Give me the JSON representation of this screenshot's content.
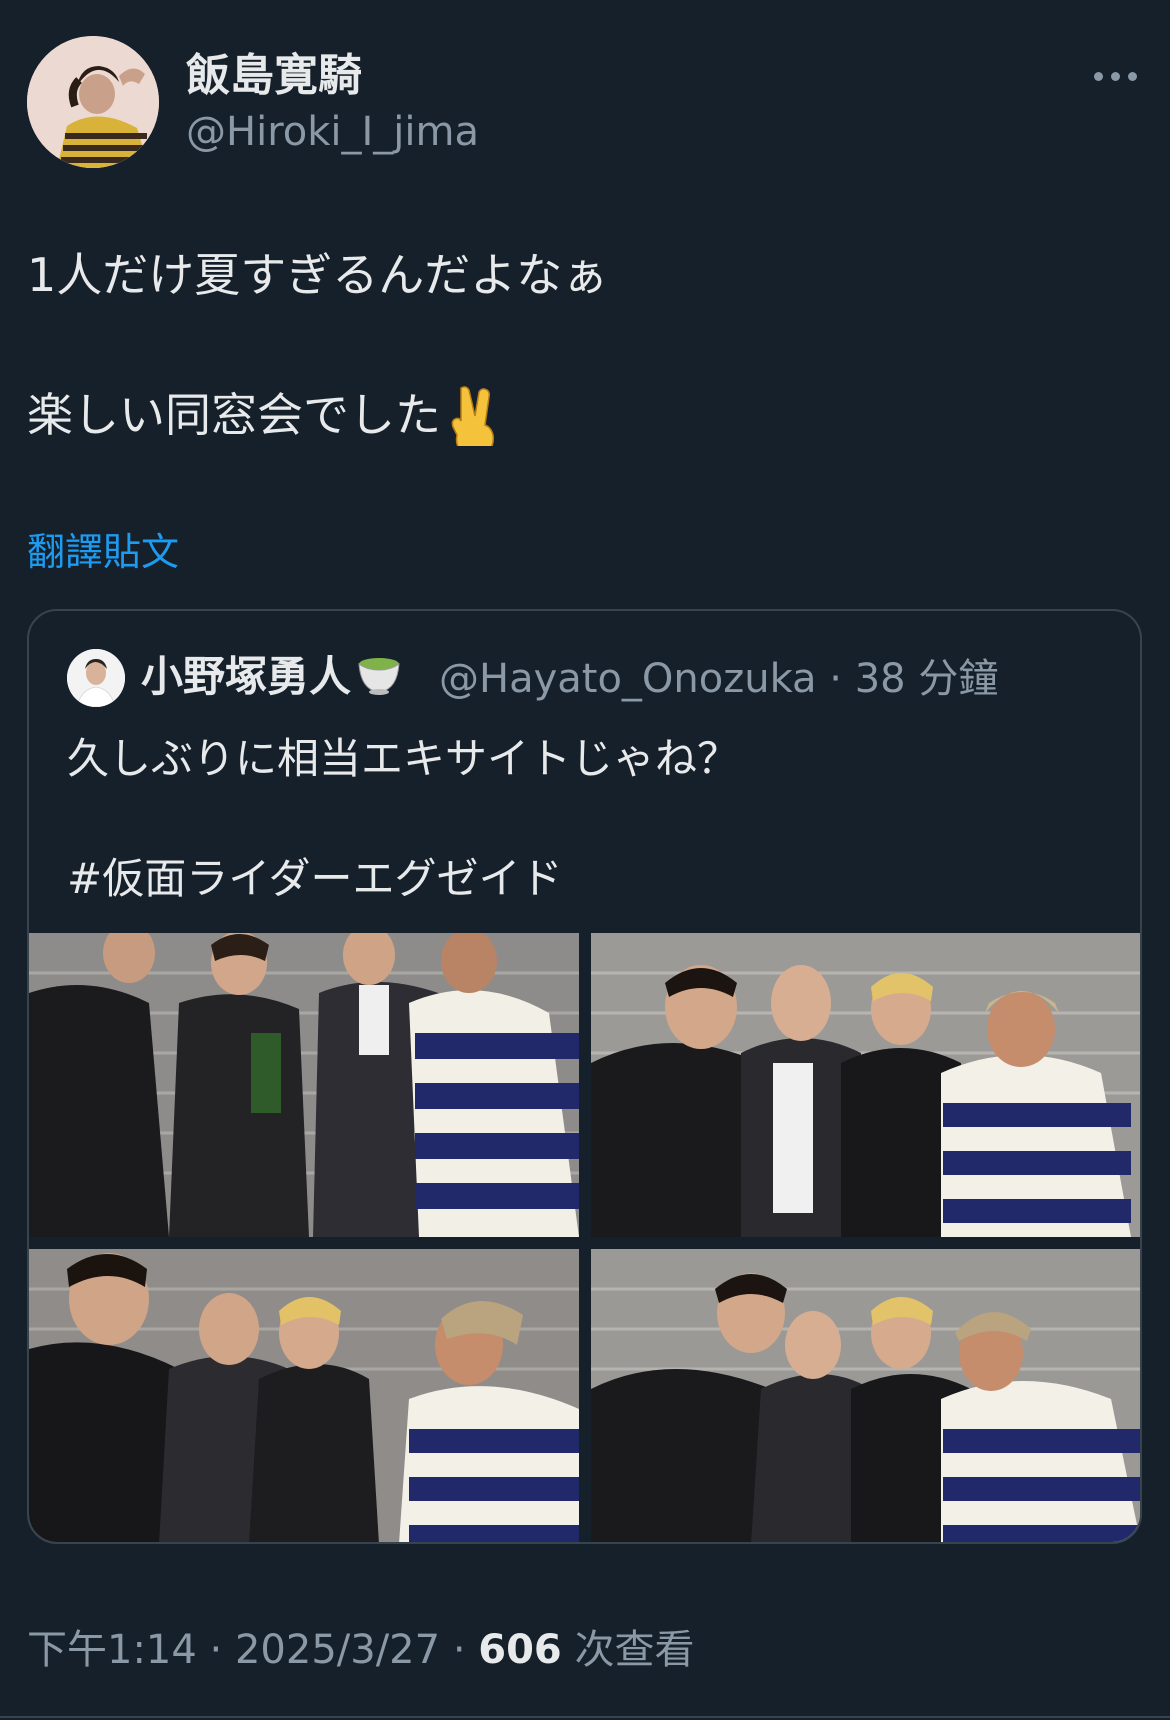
{
  "author": {
    "display_name": "飯島寛騎",
    "handle": "@Hiroki_I_jima"
  },
  "tweet": {
    "text_line1": "1人だけ夏すぎるんだよなぁ",
    "text_line2": "楽しい同窓会でした",
    "text_line2_emoji": "victory-hand-emoji",
    "translate_label": "翻譯貼文"
  },
  "quoted": {
    "display_name": "小野塚勇人",
    "name_emoji": "teacup-emoji",
    "handle": "@Hayato_Onozuka",
    "separator": "·",
    "time": "38 分鐘",
    "text_line1": "久しぶりに相当エキサイトじゃね？",
    "text_line2": "#仮面ライダーエグゼイド",
    "photos": [
      {
        "name": "group-photo-peace-signs"
      },
      {
        "name": "group-photo-arms-around"
      },
      {
        "name": "group-photo-playful"
      },
      {
        "name": "group-photo-funny-faces"
      }
    ]
  },
  "footer": {
    "time": "下午1:14",
    "sep1": "·",
    "date": "2025/3/27",
    "sep2": "·",
    "views": "606",
    "views_label": "次查看"
  },
  "colors": {
    "background": "#15202b",
    "text_primary": "#e7e9ea",
    "text_secondary": "#8b98a5",
    "link": "#1d9bf0",
    "border": "#38444d"
  }
}
